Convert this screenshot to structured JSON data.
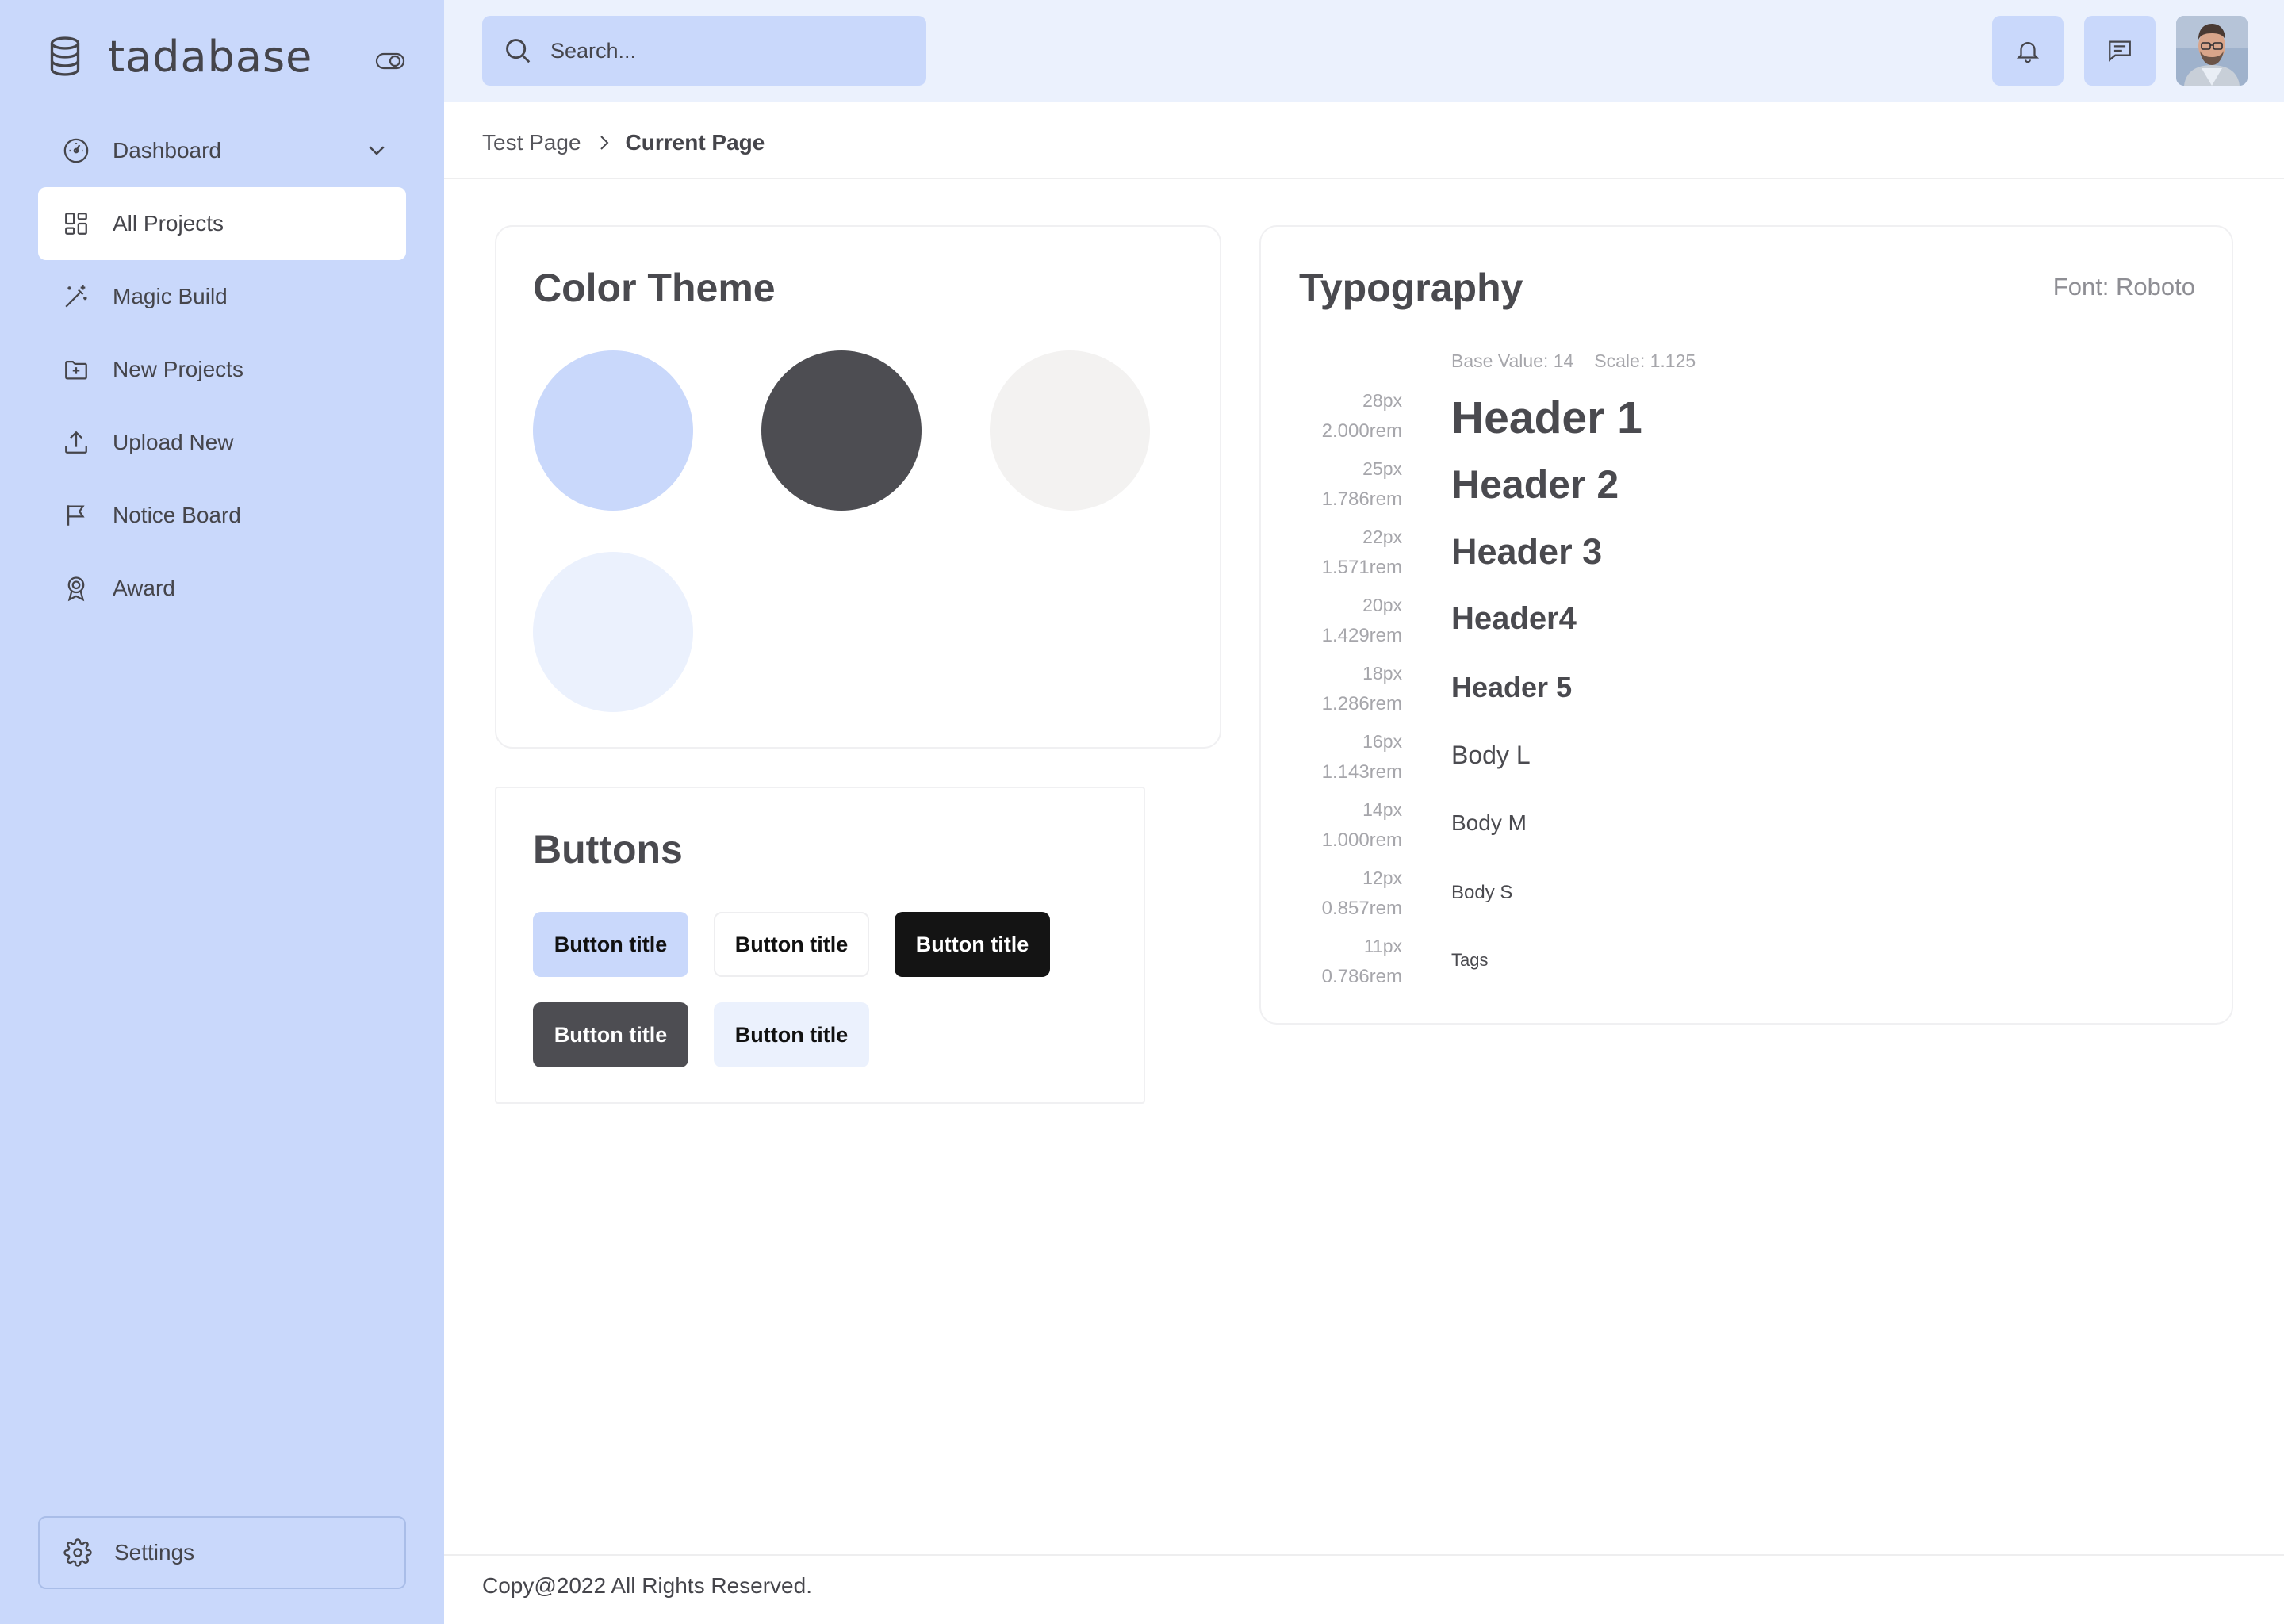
{
  "app": {
    "name": "tadabase"
  },
  "sidebar": {
    "items": [
      {
        "label": "Dashboard",
        "icon": "dashboard-gauge-icon",
        "has_submenu": true
      },
      {
        "label": "All Projects",
        "icon": "grid-icon",
        "active": true
      },
      {
        "label": "Magic Build",
        "icon": "magic-wand-icon"
      },
      {
        "label": "New Projects",
        "icon": "folder-plus-icon"
      },
      {
        "label": "Upload New",
        "icon": "upload-icon"
      },
      {
        "label": "Notice Board",
        "icon": "flag-icon"
      },
      {
        "label": "Award",
        "icon": "award-icon"
      }
    ],
    "settings_label": "Settings"
  },
  "topbar": {
    "search_placeholder": "Search...",
    "notifications_icon": "bell-icon",
    "messages_icon": "chat-icon"
  },
  "breadcrumb": {
    "parent": "Test Page",
    "current": "Current Page"
  },
  "color_theme": {
    "title": "Color Theme",
    "swatches": [
      "#c9d8fb",
      "#4d4d52",
      "#f3f2f1",
      "#ebf1fd"
    ]
  },
  "buttons": {
    "title": "Buttons",
    "items": [
      {
        "label": "Button title",
        "variant": "primary-light",
        "bg": "#c9d8fb",
        "color": "#111111"
      },
      {
        "label": "Button title",
        "variant": "outline",
        "bg": "#ffffff",
        "color": "#111111"
      },
      {
        "label": "Button title",
        "variant": "black",
        "bg": "#141414",
        "color": "#ffffff"
      },
      {
        "label": "Button title",
        "variant": "dark-gray",
        "bg": "#4d4d52",
        "color": "#ffffff"
      },
      {
        "label": "Button title",
        "variant": "pale-blue",
        "bg": "#ebf1fd",
        "color": "#111111"
      }
    ]
  },
  "typography": {
    "title": "Typography",
    "font": "Font: Roboto",
    "base_value": "Base Value: 14",
    "scale": "Scale: 1.125",
    "rows": [
      {
        "px": "28px",
        "rem": "2.000rem",
        "sample": "Header 1"
      },
      {
        "px": "25px",
        "rem": "1.786rem",
        "sample": "Header 2"
      },
      {
        "px": "22px",
        "rem": "1.571rem",
        "sample": "Header 3"
      },
      {
        "px": "20px",
        "rem": "1.429rem",
        "sample": "Header4"
      },
      {
        "px": "18px",
        "rem": "1.286rem",
        "sample": "Header 5"
      },
      {
        "px": "16px",
        "rem": "1.143rem",
        "sample": "Body L"
      },
      {
        "px": "14px",
        "rem": "1.000rem",
        "sample": "Body M"
      },
      {
        "px": "12px",
        "rem": "0.857rem",
        "sample": "Body S"
      },
      {
        "px": "11px",
        "rem": "0.786rem",
        "sample": "Tags"
      }
    ]
  },
  "footer": {
    "text": "Copy@2022 All Rights Reserved."
  }
}
